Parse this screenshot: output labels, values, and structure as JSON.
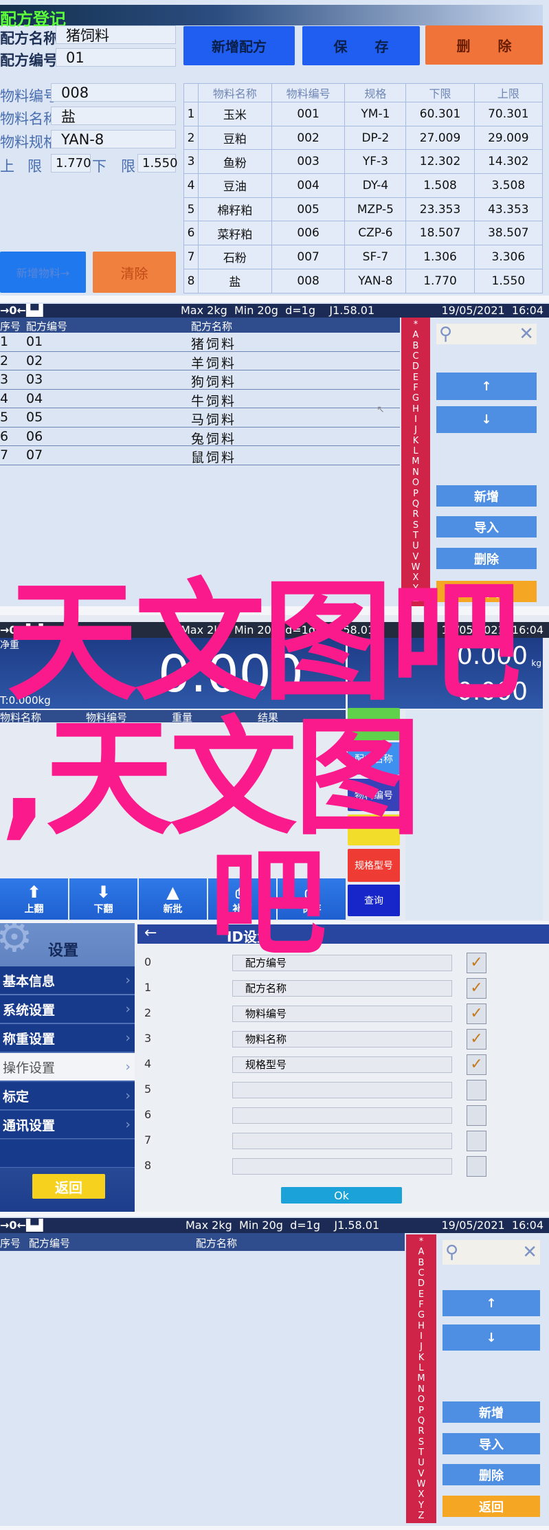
{
  "recipe_entry": {
    "title": "配方登记",
    "recipe_name_label": "配方名称",
    "recipe_name": "猪饲料",
    "recipe_no_label": "配方编号",
    "recipe_no": "01",
    "buttons": {
      "new_recipe": "新增配方",
      "save": "保　　存",
      "delete": "删　　除",
      "add_material": "新增物料→",
      "clear": "清除"
    },
    "material_no_label": "物料编号",
    "material_no": "008",
    "material_name_label": "物料名称",
    "material_name": "盐",
    "material_spec_label": "物料规格",
    "material_spec": "YAN-8",
    "upper_label_1": "上",
    "upper_label_2": "限",
    "upper_value": "1.770",
    "lower_label_1": "下",
    "lower_label_2": "限",
    "lower_value": "1.550",
    "table": {
      "headers": [
        "",
        "物料名称",
        "物料编号",
        "规格",
        "下限",
        "上限"
      ],
      "rows": [
        [
          "1",
          "玉米",
          "001",
          "YM-1",
          "60.301",
          "70.301"
        ],
        [
          "2",
          "豆粕",
          "002",
          "DP-2",
          "27.009",
          "29.009"
        ],
        [
          "3",
          "鱼粉",
          "003",
          "YF-3",
          "12.302",
          "14.302"
        ],
        [
          "4",
          "豆油",
          "004",
          "DY-4",
          "1.508",
          "3.508"
        ],
        [
          "5",
          "棉籽粕",
          "005",
          "MZP-5",
          "23.353",
          "43.353"
        ],
        [
          "6",
          "菜籽粕",
          "006",
          "CZP-6",
          "18.507",
          "38.507"
        ],
        [
          "7",
          "石粉",
          "007",
          "SF-7",
          "1.306",
          "3.306"
        ],
        [
          "8",
          "盐",
          "008",
          "YAN-8",
          "1.770",
          "1.550"
        ]
      ]
    }
  },
  "status_bar": {
    "icons": "→0←▙▟",
    "spec": "Max 2kg  Min 20g  d=1g    J1.58.01",
    "datetime": "19/05/2021  16:04"
  },
  "recipe_list": {
    "headers": {
      "index": "序号",
      "code": "配方编号",
      "name": "配方名称"
    },
    "rows": [
      [
        "1",
        "01",
        "猪饲料"
      ],
      [
        "2",
        "02",
        "羊饲料"
      ],
      [
        "3",
        "03",
        "狗饲料"
      ],
      [
        "4",
        "04",
        "牛饲料"
      ],
      [
        "5",
        "05",
        "马饲料"
      ],
      [
        "6",
        "06",
        "兔饲料"
      ],
      [
        "7",
        "07",
        "鼠饲料"
      ]
    ],
    "alphabet": [
      "*",
      "A",
      "B",
      "C",
      "D",
      "E",
      "F",
      "G",
      "H",
      "I",
      "J",
      "K",
      "L",
      "M",
      "N",
      "O",
      "P",
      "Q",
      "R",
      "S",
      "T",
      "U",
      "V",
      "W",
      "X",
      "Y",
      "Z"
    ],
    "buttons": {
      "up": "↑",
      "down": "↓",
      "add": "新增",
      "import": "导入",
      "delete": "删除",
      "back": "返回"
    }
  },
  "weighing": {
    "net_label": "净重",
    "weight": "0.000",
    "tare": "T:0.000kg",
    "side_weight_1": "0.000",
    "side_weight_2": "0.000",
    "unit": "kg",
    "headers": [
      "物料名称",
      "物料编号",
      "重量",
      "结果"
    ],
    "side_buttons": [
      "配方编号",
      "配方名称",
      "物料编号",
      "",
      "规格型号",
      "查询"
    ],
    "side_colors": [
      "#5fd14a",
      "#3d8ff0",
      "#3742b8",
      "#f3dd2b",
      "#ee3b34",
      "#1626c9"
    ],
    "toolbar": [
      {
        "icon": "arrow-up",
        "label": "上翻"
      },
      {
        "icon": "arrow-down",
        "label": "下翻"
      },
      {
        "icon": "pyramid",
        "label": "新批"
      },
      {
        "icon": "printer",
        "label": "补打"
      },
      {
        "icon": "printer",
        "label": "保存"
      }
    ]
  },
  "settings": {
    "title": "设置",
    "menu": [
      {
        "label": "基本信息"
      },
      {
        "label": "系统设置"
      },
      {
        "label": "称重设置"
      },
      {
        "label": "操作设置",
        "selected": true
      },
      {
        "label": "标定"
      },
      {
        "label": "通讯设置"
      }
    ],
    "back": "返回",
    "page_title": "ID设置",
    "rows": [
      {
        "n": "0",
        "field": "配方编号",
        "checked": true
      },
      {
        "n": "1",
        "field": "配方名称",
        "checked": true
      },
      {
        "n": "2",
        "field": "物料编号",
        "checked": true
      },
      {
        "n": "3",
        "field": "物料名称",
        "checked": true
      },
      {
        "n": "4",
        "field": "规格型号",
        "checked": true
      },
      {
        "n": "5",
        "field": "",
        "checked": false
      },
      {
        "n": "6",
        "field": "",
        "checked": false
      },
      {
        "n": "7",
        "field": "",
        "checked": false
      },
      {
        "n": "8",
        "field": "",
        "checked": false
      }
    ],
    "ok": "Ok"
  },
  "watermark": {
    "line1": "天文图吧",
    "line2": ",天文图",
    "line3": "吧"
  }
}
